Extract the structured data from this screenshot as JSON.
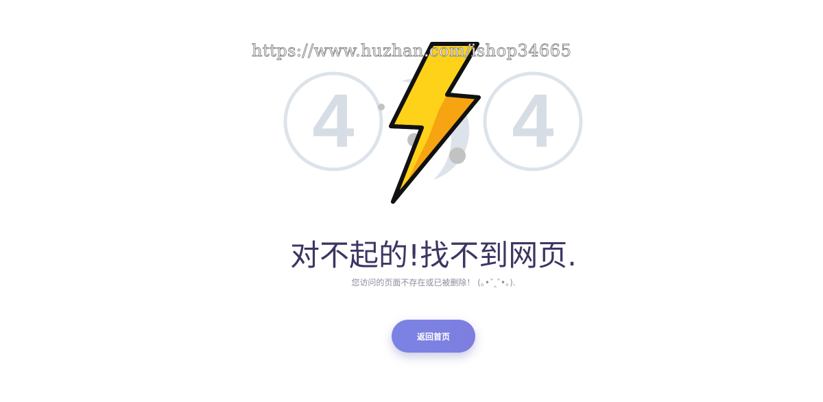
{
  "watermark": "https://www.huzhan.com/ishop34665",
  "error": {
    "digits": [
      "4",
      "4"
    ]
  },
  "message": {
    "title": "对不起的!找不到网页.",
    "subtitle": "您访问的页面不存在或已被删除！ (｡•ˇ‸ˇ•｡)."
  },
  "actions": {
    "home_label": "返回首页"
  },
  "colors": {
    "title": "#3c3663",
    "subtitle": "#8f8b9d",
    "button": "#7a83e4",
    "circle": "#dde3ea",
    "bolt": "#ffd21a"
  },
  "icons": [
    "lightning-bolt-icon"
  ]
}
